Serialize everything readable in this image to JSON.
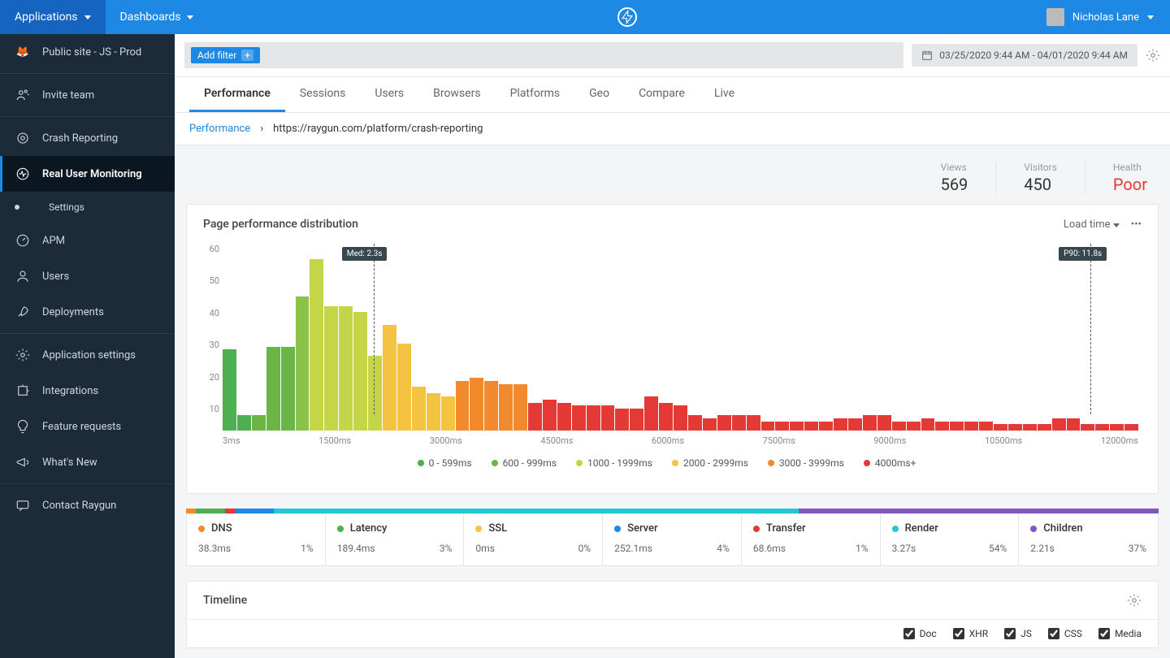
{
  "topbar": {
    "applications_label": "Applications",
    "dashboards_label": "Dashboards",
    "user_name": "Nicholas Lane"
  },
  "sidebar": {
    "items": [
      {
        "label": "Public site - JS - Prod"
      },
      {
        "label": "Invite team"
      },
      {
        "label": "Crash Reporting"
      },
      {
        "label": "Real User Monitoring"
      },
      {
        "label": "Settings"
      },
      {
        "label": "APM"
      },
      {
        "label": "Users"
      },
      {
        "label": "Deployments"
      },
      {
        "label": "Application settings"
      },
      {
        "label": "Integrations"
      },
      {
        "label": "Feature requests"
      },
      {
        "label": "What's New"
      },
      {
        "label": "Contact Raygun"
      }
    ]
  },
  "filterbar": {
    "add_filter_label": "Add filter",
    "date_range": "03/25/2020 9:44 AM - 04/01/2020 9:44 AM"
  },
  "tabs": [
    "Performance",
    "Sessions",
    "Users",
    "Browsers",
    "Platforms",
    "Geo",
    "Compare",
    "Live"
  ],
  "breadcrumb": {
    "root": "Performance",
    "page": "https://raygun.com/platform/crash-reporting"
  },
  "stats": {
    "views_label": "Views",
    "views_value": "569",
    "visitors_label": "Visitors",
    "visitors_value": "450",
    "health_label": "Health",
    "health_value": "Poor"
  },
  "distribution": {
    "title": "Page performance distribution",
    "selector": "Load time",
    "markers": {
      "median": "Med: 2.3s",
      "p90": "P90: 11.8s"
    }
  },
  "chart_data": {
    "type": "bar",
    "title": "Page performance distribution",
    "xlabel": "",
    "ylabel": "",
    "ylim": [
      0,
      60
    ],
    "yticks": [
      10,
      20,
      30,
      40,
      50,
      60
    ],
    "xticks": [
      "3ms",
      "1500ms",
      "3000ms",
      "4500ms",
      "6000ms",
      "7500ms",
      "9000ms",
      "10500ms",
      "12000ms"
    ],
    "markers": [
      {
        "label": "Med: 2.3s",
        "pos_pct": 16
      },
      {
        "label": "P90: 11.8s",
        "pos_pct": 92
      }
    ],
    "legend": [
      {
        "label": "0 - 599ms",
        "color": "#4caf50"
      },
      {
        "label": "600 - 999ms",
        "color": "#6bb547"
      },
      {
        "label": "1000 - 1999ms",
        "color": "#c4d648"
      },
      {
        "label": "2000 - 2999ms",
        "color": "#f5c342"
      },
      {
        "label": "3000 - 3999ms",
        "color": "#f08a2c"
      },
      {
        "label": "4000ms+",
        "color": "#e53935"
      }
    ],
    "values": [
      26,
      5,
      5,
      27,
      27,
      43,
      55,
      40,
      40,
      38,
      24,
      34,
      28,
      14,
      12,
      11,
      16,
      17,
      16,
      15,
      15,
      9,
      10,
      9,
      8,
      8,
      8,
      7,
      7,
      11,
      9,
      8,
      5,
      4,
      5,
      5,
      5,
      3,
      3,
      3,
      3,
      3,
      4,
      4,
      5,
      5,
      3,
      3,
      4,
      3,
      3,
      3,
      3,
      2,
      2,
      2,
      2,
      4,
      4,
      2,
      2,
      2,
      2
    ],
    "colors": [
      "#4caf50",
      "#4caf50",
      "#6bb547",
      "#6bb547",
      "#6bb547",
      "#8bc34a",
      "#c4d648",
      "#c4d648",
      "#c4d648",
      "#c4d648",
      "#c4d648",
      "#f5c342",
      "#f5c342",
      "#f5c342",
      "#f5c342",
      "#f5c342",
      "#f08a2c",
      "#f08a2c",
      "#f08a2c",
      "#f08a2c",
      "#f08a2c",
      "#e53935",
      "#e53935",
      "#e53935",
      "#e53935",
      "#e53935",
      "#e53935",
      "#e53935",
      "#e53935",
      "#e53935",
      "#e53935",
      "#e53935",
      "#e53935",
      "#e53935",
      "#e53935",
      "#e53935",
      "#e53935",
      "#e53935",
      "#e53935",
      "#e53935",
      "#e53935",
      "#e53935",
      "#e53935",
      "#e53935",
      "#e53935",
      "#e53935",
      "#e53935",
      "#e53935",
      "#e53935",
      "#e53935",
      "#e53935",
      "#e53935",
      "#e53935",
      "#e53935",
      "#e53935",
      "#e53935",
      "#e53935",
      "#e53935",
      "#e53935",
      "#e53935",
      "#e53935",
      "#e53935",
      "#e53935"
    ]
  },
  "metrics": [
    {
      "name": "DNS",
      "dot": "#f08a2c",
      "value": "38.3ms",
      "pct": "1%"
    },
    {
      "name": "Latency",
      "dot": "#4caf50",
      "value": "189.4ms",
      "pct": "3%"
    },
    {
      "name": "SSL",
      "dot": "#f5c342",
      "value": "0ms",
      "pct": "0%"
    },
    {
      "name": "Server",
      "dot": "#1e88e5",
      "value": "252.1ms",
      "pct": "4%"
    },
    {
      "name": "Transfer",
      "dot": "#e53935",
      "value": "68.6ms",
      "pct": "1%"
    },
    {
      "name": "Render",
      "dot": "#26c6da",
      "value": "3.27s",
      "pct": "54%"
    },
    {
      "name": "Children",
      "dot": "#7e57c2",
      "value": "2.21s",
      "pct": "37%"
    }
  ],
  "metric_bar_segments": [
    {
      "color": "#f08a2c",
      "w": 1
    },
    {
      "color": "#4caf50",
      "w": 3
    },
    {
      "color": "#e53935",
      "w": 1
    },
    {
      "color": "#1e88e5",
      "w": 4
    },
    {
      "color": "#26c6da",
      "w": 54
    },
    {
      "color": "#7e57c2",
      "w": 37
    }
  ],
  "timeline": {
    "title": "Timeline",
    "checks": [
      "Doc",
      "XHR",
      "JS",
      "CSS",
      "Media"
    ]
  }
}
